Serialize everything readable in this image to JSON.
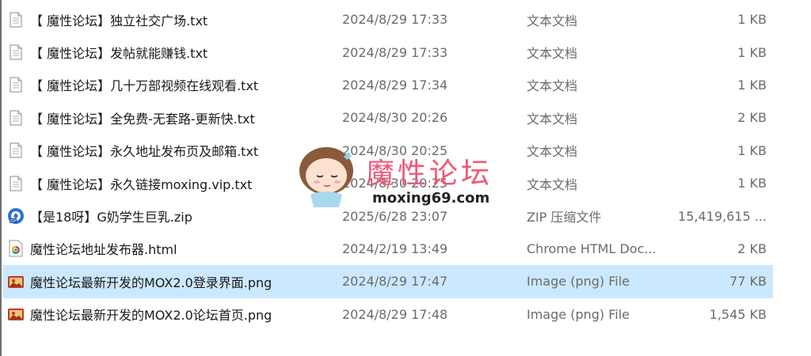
{
  "files": [
    {
      "name": "【 魔性论坛】独立社交广场.txt",
      "date": "2024/8/29 17:33",
      "type": "文本文档",
      "size": "1 KB",
      "icon": "text-file-icon"
    },
    {
      "name": "【 魔性论坛】发帖就能赚钱.txt",
      "date": "2024/8/29 17:33",
      "type": "文本文档",
      "size": "1 KB",
      "icon": "text-file-icon"
    },
    {
      "name": "【 魔性论坛】几十万部视频在线观看.txt",
      "date": "2024/8/29 17:34",
      "type": "文本文档",
      "size": "1 KB",
      "icon": "text-file-icon"
    },
    {
      "name": "【 魔性论坛】全免费-无套路-更新快.txt",
      "date": "2024/8/30 20:26",
      "type": "文本文档",
      "size": "2 KB",
      "icon": "text-file-icon"
    },
    {
      "name": "【 魔性论坛】永久地址发布页及邮箱.txt",
      "date": "2024/8/30 20:25",
      "type": "文本文档",
      "size": "1 KB",
      "icon": "text-file-icon"
    },
    {
      "name": "【 魔性论坛】永久链接moxing.vip.txt",
      "date": "2024/8/30 20:25",
      "type": "文本文档",
      "size": "1 KB",
      "icon": "text-file-icon"
    },
    {
      "name": "【是18呀】G奶学生巨乳.zip",
      "date": "2025/6/28 23:07",
      "type": "ZIP 压缩文件",
      "size": "15,419,615 ...",
      "icon": "zip-file-icon"
    },
    {
      "name": "魔性论坛地址发布器.html",
      "date": "2024/2/19 13:49",
      "type": "Chrome HTML Doc...",
      "size": "2 KB",
      "icon": "chrome-html-icon"
    },
    {
      "name": "魔性论坛最新开发的MOX2.0登录界面.png",
      "date": "2024/8/29 17:47",
      "type": "Image (png) File",
      "size": "77 KB",
      "icon": "image-file-icon",
      "selected": true
    },
    {
      "name": "魔性论坛最新开发的MOX2.0论坛首页.png",
      "date": "2024/8/29 17:48",
      "type": "Image (png) File",
      "size": "1,545 KB",
      "icon": "image-file-icon"
    }
  ],
  "watermark": {
    "title": "魔性论坛",
    "url": "moxing69.com"
  },
  "colors": {
    "selected_row": "#cce8ff",
    "watermark_title": "#ef5a78",
    "secondary_text": "#6b6b6b"
  }
}
